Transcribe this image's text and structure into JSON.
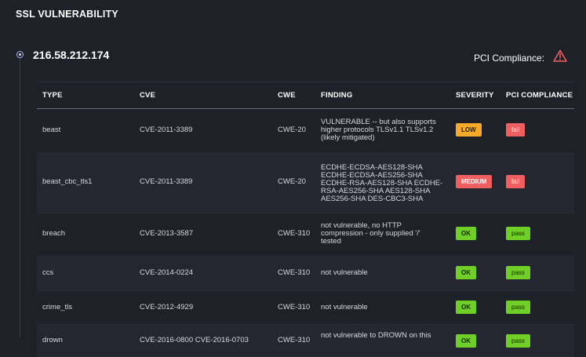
{
  "page": {
    "section_title": "SSL VULNERABILITY",
    "host_ip": "216.58.212.174",
    "pci_compliance_label": "PCI Compliance:",
    "pci_status_icon": "warning-triangle-icon",
    "colors": {
      "background": "#1f2129",
      "warning": "#ef5f5f",
      "low": "#f7a928",
      "ok": "#6fcf26"
    }
  },
  "table": {
    "headers": {
      "type": "TYPE",
      "cve": "CVE",
      "cwe": "CWE",
      "finding": "FINDING",
      "severity": "SEVERITY",
      "pci": "PCI COMPLIANCE"
    },
    "rows": [
      {
        "type": "beast",
        "cve": "CVE-2011-3389",
        "cwe": "CWE-20",
        "finding": [
          "VULNERABLE -- but also supports",
          "higher protocols TLSv1.1 TLSv1.2",
          "(likely mitigated)"
        ],
        "severity": "LOW",
        "pci": "fail"
      },
      {
        "type": "beast_cbc_tls1",
        "cve": "CVE-2011-3389",
        "cwe": "CWE-20",
        "finding": [
          "ECDHE-ECDSA-AES128-SHA",
          "ECDHE-ECDSA-AES256-SHA",
          "ECDHE-RSA-AES128-SHA ECDHE-",
          "RSA-AES256-SHA AES128-SHA",
          "AES256-SHA DES-CBC3-SHA"
        ],
        "severity": "MEDIUM",
        "pci": "fail"
      },
      {
        "type": "breach",
        "cve": "CVE-2013-3587",
        "cwe": "CWE-310",
        "finding": [
          "not vulnerable, no HTTP",
          "compression - only supplied '/'",
          "tested"
        ],
        "severity": "OK",
        "pci": "pass"
      },
      {
        "type": "ccs",
        "cve": "CVE-2014-0224",
        "cwe": "CWE-310",
        "finding": [
          "not vulnerable"
        ],
        "severity": "OK",
        "pci": "pass"
      },
      {
        "type": "crime_tls",
        "cve": "CVE-2012-4929",
        "cwe": "CWE-310",
        "finding": [
          "not vulnerable"
        ],
        "severity": "OK",
        "pci": "pass"
      },
      {
        "type": "drown",
        "cve": "CVE-2016-0800 CVE-2016-0703",
        "cwe": "CWE-310",
        "finding": [
          "not vulnerable to DROWN on this"
        ],
        "severity": "OK",
        "pci": "pass"
      }
    ]
  }
}
